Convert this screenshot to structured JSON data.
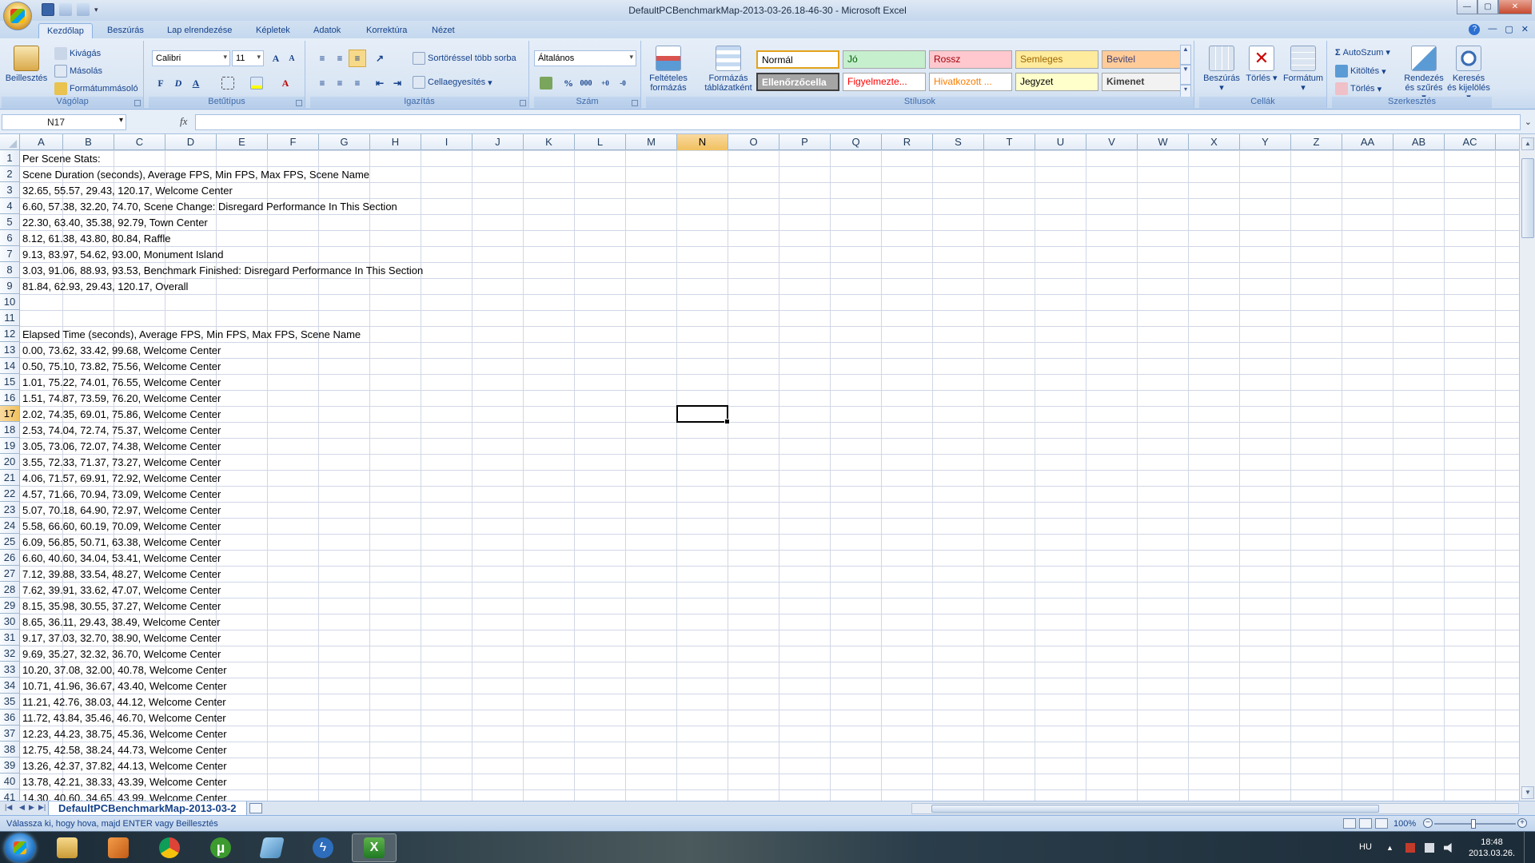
{
  "window": {
    "title": "DefaultPCBenchmarkMap-2013-03-26.18-46-30 - Microsoft Excel"
  },
  "tabs": [
    {
      "label": "Kezdőlap",
      "active": true
    },
    {
      "label": "Beszúrás"
    },
    {
      "label": "Lap elrendezése"
    },
    {
      "label": "Képletek"
    },
    {
      "label": "Adatok"
    },
    {
      "label": "Korrektúra"
    },
    {
      "label": "Nézet"
    }
  ],
  "ribbon": {
    "clipboard": {
      "group": "Vágólap",
      "paste": "Beillesztés",
      "cut": "Kivágás",
      "copy": "Másolás",
      "format_painter": "Formátummásoló"
    },
    "font": {
      "group": "Betűtípus",
      "font_name": "Calibri",
      "font_size": "11",
      "bold": "F",
      "italic": "D",
      "underline": "A"
    },
    "alignment": {
      "group": "Igazítás",
      "wrap": "Sortöréssel több sorba",
      "merge": "Cellaegyesítés"
    },
    "number": {
      "group": "Szám",
      "format": "Általános",
      "percent": "%",
      "thousands": "000"
    },
    "styles": {
      "group": "Stílusok",
      "cond_format": "Feltételes formázás",
      "format_table": "Formázás táblázatként",
      "items": [
        {
          "label": "Normál",
          "bg": "#ffffff",
          "color": "#000000"
        },
        {
          "label": "Jó",
          "bg": "#c6efce",
          "color": "#006100"
        },
        {
          "label": "Rossz",
          "bg": "#ffc7ce",
          "color": "#9c0006"
        },
        {
          "label": "Semleges",
          "bg": "#ffeb9c",
          "color": "#9c6500"
        },
        {
          "label": "Bevitel",
          "bg": "#ffcc99",
          "color": "#3f3f76"
        },
        {
          "label": "Ellenőrzőcella",
          "bg": "#a5a5a5",
          "color": "#ffffff"
        },
        {
          "label": "Figyelmezte...",
          "bg": "#ffffff",
          "color": "#ff0000"
        },
        {
          "label": "Hivatkozott ...",
          "bg": "#ffffff",
          "color": "#fa7d00"
        },
        {
          "label": "Jegyzet",
          "bg": "#ffffcc",
          "color": "#000000"
        },
        {
          "label": "Kimenet",
          "bg": "#f2f2f2",
          "color": "#3f3f3f"
        }
      ]
    },
    "cells": {
      "group": "Cellák",
      "insert": "Beszúrás",
      "delete": "Törlés",
      "format": "Formátum"
    },
    "editing": {
      "group": "Szerkesztés",
      "autosum": "AutoSzum",
      "fill": "Kitöltés",
      "clear": "Törlés",
      "sort": "Rendezés és szűrés",
      "find": "Keresés és kijelölés"
    }
  },
  "formula_bar": {
    "name_box": "N17",
    "fx": "fx",
    "value": ""
  },
  "columns": [
    "A",
    "B",
    "C",
    "D",
    "E",
    "F",
    "G",
    "H",
    "I",
    "J",
    "K",
    "L",
    "M",
    "N",
    "O",
    "P",
    "Q",
    "R",
    "S",
    "T",
    "U",
    "V",
    "W",
    "X",
    "Y",
    "Z",
    "AA",
    "AB",
    "AC"
  ],
  "selected": {
    "column": "N",
    "row": "17"
  },
  "rows": [
    {
      "n": "1",
      "a": "Per Scene Stats:"
    },
    {
      "n": "2",
      "a": "Scene Duration (seconds), Average FPS, Min FPS, Max FPS, Scene Name"
    },
    {
      "n": "3",
      "a": "32.65, 55.57, 29.43, 120.17, Welcome Center"
    },
    {
      "n": "4",
      "a": "6.60, 57.38, 32.20, 74.70, Scene Change: Disregard Performance In This Section"
    },
    {
      "n": "5",
      "a": "22.30, 63.40, 35.38, 92.79, Town Center"
    },
    {
      "n": "6",
      "a": "8.12, 61.38, 43.80, 80.84, Raffle"
    },
    {
      "n": "7",
      "a": "9.13, 83.97, 54.62, 93.00, Monument Island"
    },
    {
      "n": "8",
      "a": "3.03, 91.06, 88.93, 93.53, Benchmark Finished: Disregard Performance In This Section"
    },
    {
      "n": "9",
      "a": "81.84, 62.93, 29.43, 120.17, Overall"
    },
    {
      "n": "10",
      "a": ""
    },
    {
      "n": "11",
      "a": ""
    },
    {
      "n": "12",
      "a": "Elapsed Time (seconds), Average FPS, Min FPS, Max FPS, Scene Name"
    },
    {
      "n": "13",
      "a": "0.00, 73.62, 33.42, 99.68, Welcome Center"
    },
    {
      "n": "14",
      "a": "0.50, 75.10, 73.82, 75.56, Welcome Center"
    },
    {
      "n": "15",
      "a": "1.01, 75.22, 74.01, 76.55, Welcome Center"
    },
    {
      "n": "16",
      "a": "1.51, 74.87, 73.59, 76.20, Welcome Center"
    },
    {
      "n": "17",
      "a": "2.02, 74.35, 69.01, 75.86, Welcome Center"
    },
    {
      "n": "18",
      "a": "2.53, 74.04, 72.74, 75.37, Welcome Center"
    },
    {
      "n": "19",
      "a": "3.05, 73.06, 72.07, 74.38, Welcome Center"
    },
    {
      "n": "20",
      "a": "3.55, 72.33, 71.37, 73.27, Welcome Center"
    },
    {
      "n": "21",
      "a": "4.06, 71.57, 69.91, 72.92, Welcome Center"
    },
    {
      "n": "22",
      "a": "4.57, 71.66, 70.94, 73.09, Welcome Center"
    },
    {
      "n": "23",
      "a": "5.07, 70.18, 64.90, 72.97, Welcome Center"
    },
    {
      "n": "24",
      "a": "5.58, 66.60, 60.19, 70.09, Welcome Center"
    },
    {
      "n": "25",
      "a": "6.09, 56.85, 50.71, 63.38, Welcome Center"
    },
    {
      "n": "26",
      "a": "6.60, 40.60, 34.04, 53.41, Welcome Center"
    },
    {
      "n": "27",
      "a": "7.12, 39.88, 33.54, 48.27, Welcome Center"
    },
    {
      "n": "28",
      "a": "7.62, 39.91, 33.62, 47.07, Welcome Center"
    },
    {
      "n": "29",
      "a": "8.15, 35.98, 30.55, 37.27, Welcome Center"
    },
    {
      "n": "30",
      "a": "8.65, 36.11, 29.43, 38.49, Welcome Center"
    },
    {
      "n": "31",
      "a": "9.17, 37.03, 32.70, 38.90, Welcome Center"
    },
    {
      "n": "32",
      "a": "9.69, 35.27, 32.32, 36.70, Welcome Center"
    },
    {
      "n": "33",
      "a": "10.20, 37.08, 32.00, 40.78, Welcome Center"
    },
    {
      "n": "34",
      "a": "10.71, 41.96, 36.67, 43.40, Welcome Center"
    },
    {
      "n": "35",
      "a": "11.21, 42.76, 38.03, 44.12, Welcome Center"
    },
    {
      "n": "36",
      "a": "11.72, 43.84, 35.46, 46.70, Welcome Center"
    },
    {
      "n": "37",
      "a": "12.23, 44.23, 38.75, 45.36, Welcome Center"
    },
    {
      "n": "38",
      "a": "12.75, 42.58, 38.24, 44.73, Welcome Center"
    },
    {
      "n": "39",
      "a": "13.26, 42.37, 37.82, 44.13, Welcome Center"
    },
    {
      "n": "40",
      "a": "13.78, 42.21, 38.33, 43.39, Welcome Center"
    },
    {
      "n": "41",
      "a": "14.30, 40.60, 34.65, 43.99, Welcome Center"
    }
  ],
  "sheet_tab": "DefaultPCBenchmarkMap-2013-03-2",
  "status": {
    "message": "Válassza ki, hogy hova, majd ENTER vagy Beillesztés",
    "zoom": "100%"
  },
  "taskbar": {
    "apps": [
      "windows-explorer-icon",
      "media-player-icon",
      "chrome-icon",
      "utorrent-icon",
      "paint-icon",
      "flash-icon",
      "excel-icon"
    ],
    "language": "HU",
    "time": "18:48",
    "date": "2013.03.26."
  }
}
